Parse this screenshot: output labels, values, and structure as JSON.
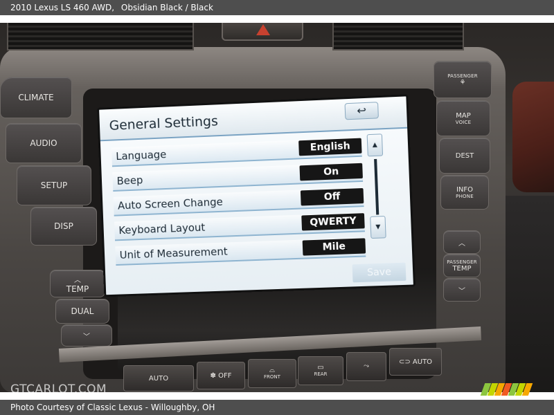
{
  "caption_top": {
    "vehicle": "2010 Lexus LS 460 AWD,",
    "color": "Obsidian Black / Black"
  },
  "caption_bottom": {
    "text": "Photo Courtesy of Classic Lexus - Willoughby, OH"
  },
  "watermark": "GTCARLOT.COM",
  "left_buttons": {
    "climate": "CLIMATE",
    "audio": "AUDIO",
    "setup": "SETUP",
    "disp": "DISP",
    "temp": "TEMP",
    "dual": "DUAL"
  },
  "right_buttons": {
    "passenger": "PASSENGER",
    "map": "MAP",
    "voice": "VOICE",
    "dest": "DEST",
    "info": "INFO",
    "phone": "PHONE",
    "passenger_temp_1": "PASSENGER",
    "passenger_temp_2": "TEMP"
  },
  "bottom_buttons": {
    "auto": "AUTO",
    "off": "OFF",
    "front": "FRONT",
    "rear": "REAR",
    "auto_right": "AUTO"
  },
  "screen": {
    "title": "General Settings",
    "back_symbol": "↩",
    "rows": [
      {
        "label": "Language",
        "value": "English"
      },
      {
        "label": "Beep",
        "value": "On"
      },
      {
        "label": "Auto Screen Change",
        "value": "Off"
      },
      {
        "label": "Keyboard Layout",
        "value": "QWERTY"
      },
      {
        "label": "Unit of Measurement",
        "value": "Mile"
      }
    ],
    "save": "Save"
  },
  "logo_colors": [
    "#8cc63f",
    "#c4d600",
    "#f7a800",
    "#f15a22",
    "#8cc63f",
    "#c4d600",
    "#f7a800"
  ]
}
